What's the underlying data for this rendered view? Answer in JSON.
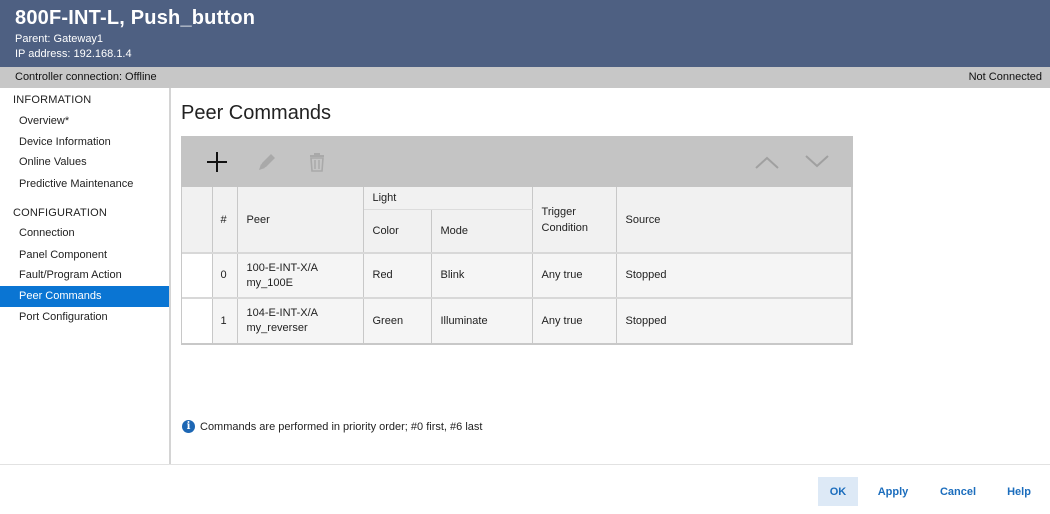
{
  "header": {
    "title": "800F-INT-L, Push_button",
    "parent": "Parent:  Gateway1",
    "ip": "IP address:  192.168.1.4"
  },
  "status": {
    "left": "Controller connection: Offline",
    "right": "Not Connected"
  },
  "sidebar": {
    "info_section": "INFORMATION",
    "info_items": [
      "Overview*",
      "Device Information",
      "Online Values",
      "Predictive Maintenance"
    ],
    "config_section": "CONFIGURATION",
    "config_items": [
      "Connection",
      "Panel Component",
      "Fault/Program Action",
      "Peer Commands",
      "Port Configuration"
    ],
    "active_item": "Peer Commands"
  },
  "page_title": "Peer Commands",
  "toolbar": {
    "icons": [
      "add-icon",
      "edit-icon",
      "delete-icon",
      "move-up-icon",
      "move-down-icon"
    ]
  },
  "table": {
    "group_header": "Light",
    "columns": [
      "#",
      "Peer",
      "Color",
      "Mode",
      "Trigger Condition",
      "Source"
    ],
    "rows": [
      {
        "num": "0",
        "peer_line1": "100-E-INT-X/A",
        "peer_line2": "my_100E",
        "color": "Red",
        "mode": "Blink",
        "trigger": "Any true",
        "source": "Stopped"
      },
      {
        "num": "1",
        "peer_line1": "104-E-INT-X/A",
        "peer_line2": "my_reverser",
        "color": "Green",
        "mode": "Illuminate",
        "trigger": "Any true",
        "source": "Stopped"
      }
    ]
  },
  "notice": "Commands are performed in priority order; #0 first, #6 last",
  "footer": {
    "ok": "OK",
    "apply": "Apply",
    "cancel": "Cancel",
    "help": "Help"
  },
  "colors": {
    "header_bg": "#4e6082",
    "active_item": "#0a75d3",
    "link": "#1b6dbd"
  }
}
